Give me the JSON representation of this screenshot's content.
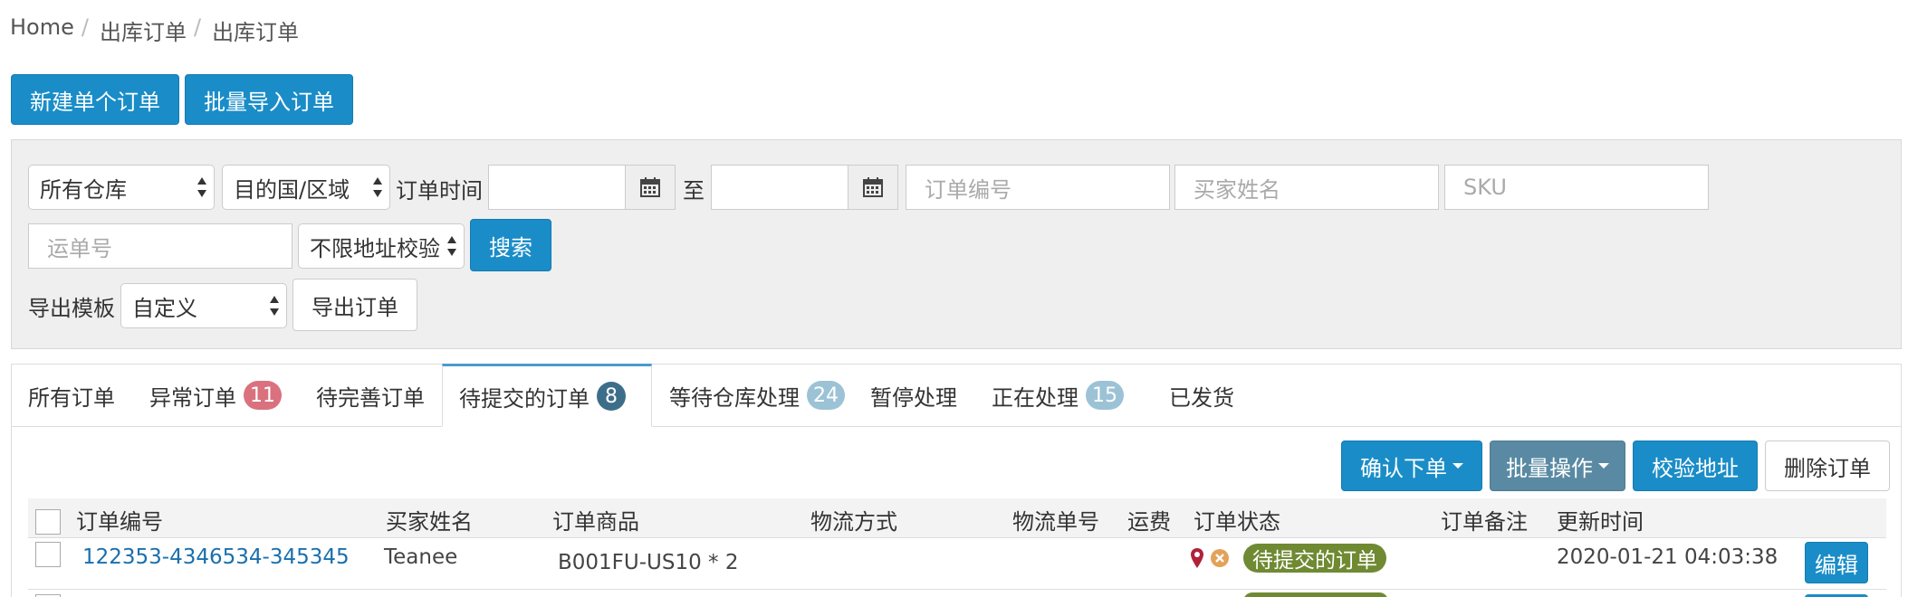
{
  "breadcrumb": {
    "home": "Home",
    "level1": "出库订单",
    "level2": "出库订单"
  },
  "actions": {
    "new_order": "新建单个订单",
    "batch_import": "批量导入订单"
  },
  "filters": {
    "warehouse": "所有仓库",
    "country": "目的国/区域",
    "order_time_label": "订单时间",
    "to_label": "至",
    "order_no_placeholder": "订单编号",
    "buyer_name_placeholder": "买家姓名",
    "sku_placeholder": "SKU",
    "tracking_placeholder": "运单号",
    "address_check": "不限地址校验",
    "search_label": "搜索",
    "export_template_label": "导出模板",
    "export_template_value": "自定义",
    "export_button": "导出订单"
  },
  "tabs": [
    {
      "label": "所有订单"
    },
    {
      "label": "异常订单",
      "count": "11"
    },
    {
      "label": "待完善订单"
    },
    {
      "label": "待提交的订单",
      "count": "8"
    },
    {
      "label": "等待仓库处理",
      "count": "24"
    },
    {
      "label": "暂停处理"
    },
    {
      "label": "正在处理",
      "count": "15"
    },
    {
      "label": "已发货"
    }
  ],
  "toolbar": {
    "confirm": "确认下单",
    "batch": "批量操作",
    "verify": "校验地址",
    "delete": "删除订单"
  },
  "table": {
    "columns": [
      "订单编号",
      "买家姓名",
      "订单商品",
      "物流方式",
      "物流单号",
      "运费",
      "订单状态",
      "订单备注",
      "更新时间"
    ],
    "rows": [
      {
        "order_no": "122353-4346534-345345",
        "buyer": "Teanee",
        "items": "B001FU-US10 * 2",
        "method": "",
        "tracking": "",
        "fee": "",
        "status": "待提交的订单",
        "remark": "",
        "updated": "2020-01-21 04:03:38",
        "edit": "编辑"
      }
    ]
  },
  "colors": {
    "primary": "#1a8dc8",
    "badge_red": "#d9727e",
    "badge_dark": "#3d6e89",
    "badge_light": "#9cc2d6",
    "status_green": "#6f8a32"
  }
}
